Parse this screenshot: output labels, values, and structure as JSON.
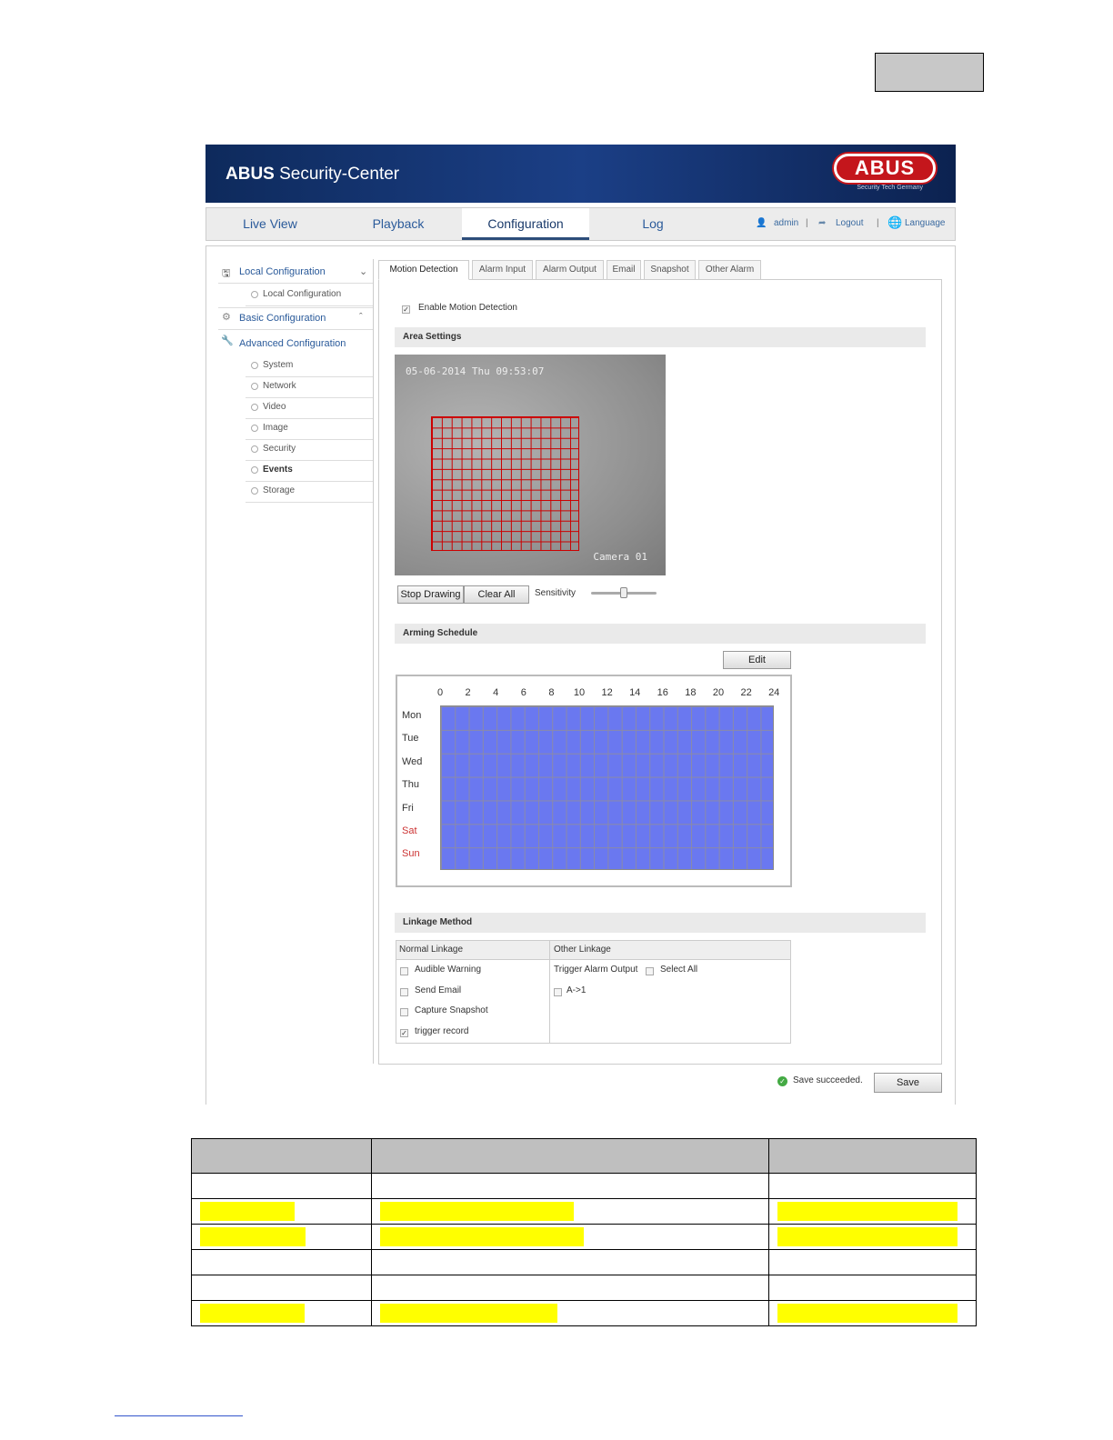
{
  "app": {
    "title_bold": "ABUS",
    "title_rest": " Security-Center",
    "logo_text": "ABUS",
    "logo_sub": "Security Tech Germany"
  },
  "nav": {
    "tabs": [
      "Live View",
      "Playback",
      "Configuration",
      "Log"
    ],
    "active": "Configuration",
    "user": "admin",
    "logout": "Logout",
    "language": "Language",
    "sep": "|"
  },
  "sidebar": {
    "local": "Local Configuration",
    "local_sub": "Local Configuration",
    "basic": "Basic Configuration",
    "advanced": "Advanced Configuration",
    "items": [
      "System",
      "Network",
      "Video",
      "Image",
      "Security",
      "Events",
      "Storage"
    ],
    "active": "Events"
  },
  "tabs": [
    "Motion Detection",
    "Alarm Input",
    "Alarm Output",
    "Email",
    "Snapshot",
    "Other Alarm"
  ],
  "motion": {
    "enable_label": "Enable Motion Detection",
    "enabled": true,
    "area_title": "Area Settings",
    "timestamp": "05-06-2014 Thu 09:53:07",
    "camera": "Camera 01",
    "stop_drawing": "Stop Drawing",
    "clear_all": "Clear All",
    "sensitivity_label": "Sensitivity",
    "sensitivity_pct": 50
  },
  "schedule": {
    "title": "Arming Schedule",
    "edit": "Edit",
    "hours": [
      "0",
      "2",
      "4",
      "6",
      "8",
      "10",
      "12",
      "14",
      "16",
      "18",
      "20",
      "22",
      "24"
    ],
    "days": [
      "Mon",
      "Tue",
      "Wed",
      "Thu",
      "Fri",
      "Sat",
      "Sun"
    ],
    "coverage": "all days 0-24 armed"
  },
  "linkage": {
    "title": "Linkage Method",
    "normal_header": "Normal Linkage",
    "other_header": "Other Linkage",
    "normal": [
      {
        "label": "Audible Warning",
        "checked": false
      },
      {
        "label": "Send Email",
        "checked": false
      },
      {
        "label": "Capture Snapshot",
        "checked": false
      },
      {
        "label": "trigger record",
        "checked": true
      }
    ],
    "trigger_alarm_output": "Trigger Alarm Output",
    "select_all": "Select All",
    "output": "A->1"
  },
  "footer": {
    "status": "Save succeeded.",
    "save": "Save"
  },
  "colors": {
    "schedule_fill": "#6a78f0",
    "highlight": "#ffff00",
    "grid": "#cc0000"
  }
}
